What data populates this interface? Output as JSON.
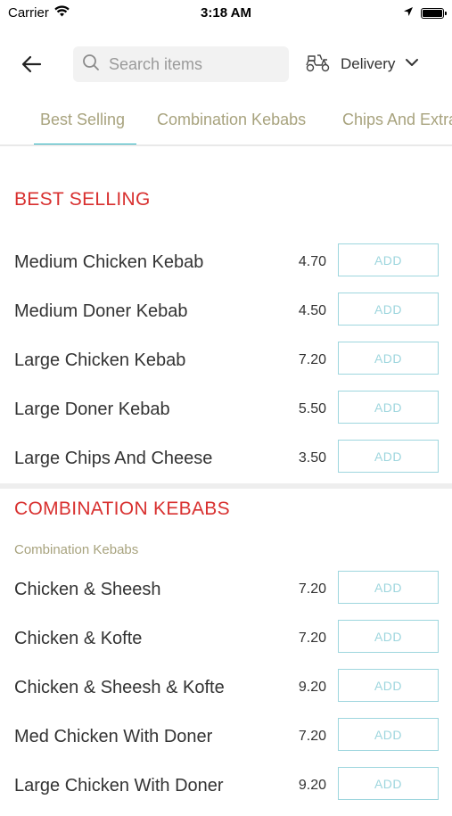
{
  "status": {
    "carrier": "Carrier",
    "time": "3:18 AM"
  },
  "header": {
    "search_placeholder": "Search items",
    "delivery_label": "Delivery"
  },
  "tabs": [
    {
      "label": "Best Selling",
      "active": true
    },
    {
      "label": "Combination Kebabs",
      "active": false
    },
    {
      "label": "Chips And Extras",
      "active": false
    }
  ],
  "sections": {
    "best_selling": {
      "title": "BEST SELLING",
      "items": [
        {
          "name": "Medium Chicken Kebab",
          "price": "4.70",
          "add": "ADD"
        },
        {
          "name": "Medium Doner Kebab",
          "price": "4.50",
          "add": "ADD"
        },
        {
          "name": "Large Chicken Kebab",
          "price": "7.20",
          "add": "ADD"
        },
        {
          "name": "Large Doner Kebab",
          "price": "5.50",
          "add": "ADD"
        },
        {
          "name": "Large Chips And Cheese",
          "price": "3.50",
          "add": "ADD"
        }
      ]
    },
    "combination": {
      "title": "COMBINATION KEBABS",
      "subtitle": "Combination Kebabs",
      "items": [
        {
          "name": "Chicken & Sheesh",
          "price": "7.20",
          "add": "ADD"
        },
        {
          "name": "Chicken & Kofte",
          "price": "7.20",
          "add": "ADD"
        },
        {
          "name": "Chicken & Sheesh & Kofte",
          "price": "9.20",
          "add": "ADD"
        },
        {
          "name": "Med Chicken With Doner",
          "price": "7.20",
          "add": "ADD"
        },
        {
          "name": "Large Chicken With Doner",
          "price": "9.20",
          "add": "ADD"
        }
      ]
    }
  },
  "colors": {
    "accent": "#27b0bd",
    "section_title": "#d8302f",
    "tab_text": "#a8a37e",
    "add_border": "#9ed6de"
  }
}
